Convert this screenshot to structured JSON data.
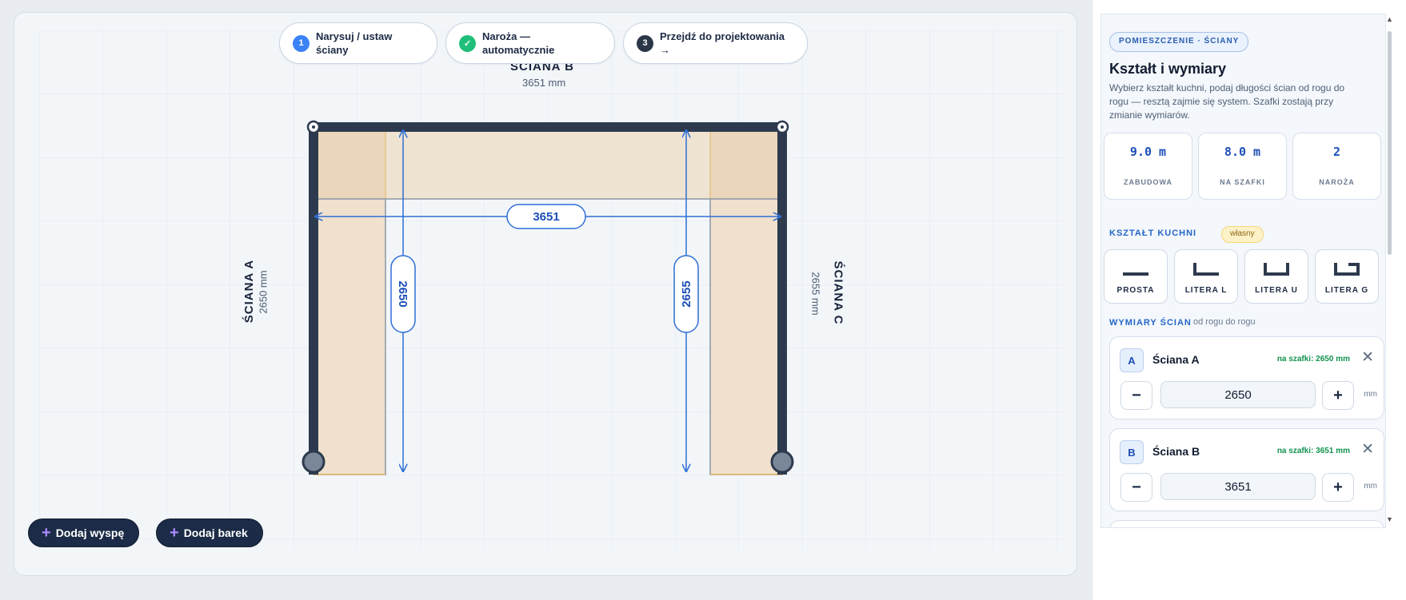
{
  "steps": [
    {
      "num": "1",
      "label": "Narysuj / ustaw ściany",
      "color": "#3b82f6"
    },
    {
      "num": "✓",
      "label": "Naroża — automatycznie",
      "color": "#1fbf7a"
    },
    {
      "num": "3",
      "label": "Przejdź do projektowania →",
      "color": "#2b3648"
    }
  ],
  "walls": {
    "a": {
      "label": "ŚCIANA A",
      "mm": "2650 mm",
      "dim": "2650"
    },
    "b": {
      "label": "ŚCIANA B",
      "mm": "3651 mm",
      "dim": "3651"
    },
    "c": {
      "label": "ŚCIANA C",
      "mm": "2655 mm",
      "dim": "2655"
    }
  },
  "bottom_buttons": {
    "add_island": "Dodaj wyspę",
    "add_bar": "Dodaj barek"
  },
  "panel": {
    "pill": "POMIESZCZENIE · ŚCIANY",
    "title": "Kształt i wymiary",
    "description": "Wybierz kształt kuchni, podaj długości ścian od rogu do rogu — resztą zajmie się system. Szafki zostają przy zmianie wymiarów.",
    "stats": [
      {
        "value": "9.0 m",
        "label": "ZABUDOWA"
      },
      {
        "value": "8.0 m",
        "label": "NA SZAFKI"
      },
      {
        "value": "2",
        "label": "NAROŻA"
      }
    ],
    "shape_heading": "KSZTAŁT KUCHNI",
    "shape_badge": "własny",
    "shapes": [
      "PROSTA",
      "LITERA L",
      "LITERA U",
      "LITERA G"
    ],
    "dims_heading": "WYMIARY ŚCIAN",
    "dims_sub": "od rogu do rogu",
    "wall_cards": [
      {
        "letter": "A",
        "name": "Ściana A",
        "cabinets": "na szafki: 2650 mm",
        "value": "2650",
        "unit": "mm"
      },
      {
        "letter": "B",
        "name": "Ściana B",
        "cabinets": "na szafki: 3651 mm",
        "value": "3651",
        "unit": "mm"
      }
    ],
    "minus": "−",
    "plus": "+",
    "close": "✕"
  },
  "colors": {
    "wall": "#2d3a4e",
    "dimension": "#2f6fd6",
    "cabinet": "#ead9c1",
    "accent": "#1d4fb8"
  }
}
